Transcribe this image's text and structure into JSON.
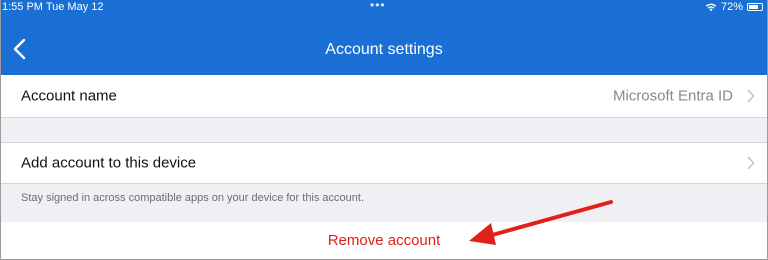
{
  "status_bar": {
    "time_date": "1:55 PM  Tue May 12",
    "dots": "•••",
    "battery": "72%",
    "battery_level": 0.72
  },
  "nav": {
    "title": "Account settings",
    "back_icon": "chevron-left-icon"
  },
  "rows": {
    "account_name": {
      "label": "Account name",
      "value": "Microsoft Entra ID"
    },
    "add_account": {
      "label": "Add account to this device",
      "note": "Stay signed in across compatible apps on your device for this account."
    }
  },
  "remove_account": {
    "label": "Remove account"
  },
  "colors": {
    "accent": "#1a6fd4",
    "destructive": "#e0201b",
    "annotation_arrow": "#e0201b"
  }
}
